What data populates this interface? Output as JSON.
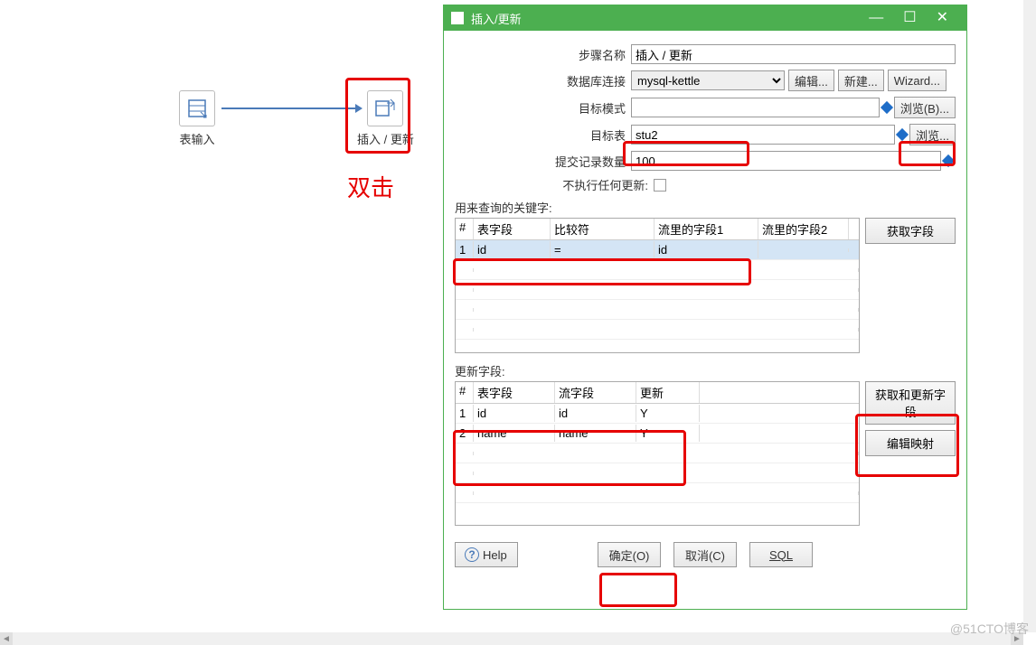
{
  "canvas": {
    "node1_label": "表输入",
    "node2_label": "插入 / 更新",
    "dblclick_text": "双击"
  },
  "dialog": {
    "title": "插入/更新",
    "step_name_label": "步骤名称",
    "step_name_value": "插入 / 更新",
    "db_conn_label": "数据库连接",
    "db_conn_value": "mysql-kettle",
    "edit_btn": "编辑...",
    "new_btn": "新建...",
    "wizard_btn": "Wizard...",
    "target_schema_label": "目标模式",
    "target_schema_value": "",
    "browse_b_btn": "浏览(B)...",
    "target_table_label": "目标表",
    "target_table_value": "stu2",
    "browse_btn": "浏览...",
    "commit_label": "提交记录数量",
    "commit_value": "100",
    "noupdate_label": "不执行任何更新:",
    "key_section_label": "用来查询的关键字:",
    "key_headers": {
      "num": "#",
      "field": "表字段",
      "cmp": "比较符",
      "stream1": "流里的字段1",
      "stream2": "流里的字段2"
    },
    "key_rows": [
      {
        "num": "1",
        "field": "id",
        "cmp": "=",
        "stream1": "id",
        "stream2": ""
      }
    ],
    "get_fields_btn": "获取字段",
    "update_section_label": "更新字段:",
    "update_headers": {
      "num": "#",
      "field": "表字段",
      "stream": "流字段",
      "update": "更新"
    },
    "update_rows": [
      {
        "num": "1",
        "field": "id",
        "stream": "id",
        "update": "Y"
      },
      {
        "num": "2",
        "field": "name",
        "stream": "name",
        "update": "Y"
      }
    ],
    "get_update_fields_btn": "获取和更新字段",
    "edit_mapping_btn": "编辑映射",
    "help_btn": "Help",
    "ok_btn": "确定(O)",
    "cancel_btn": "取消(C)",
    "sql_btn": "SQL"
  },
  "watermark": "@51CTO博客"
}
